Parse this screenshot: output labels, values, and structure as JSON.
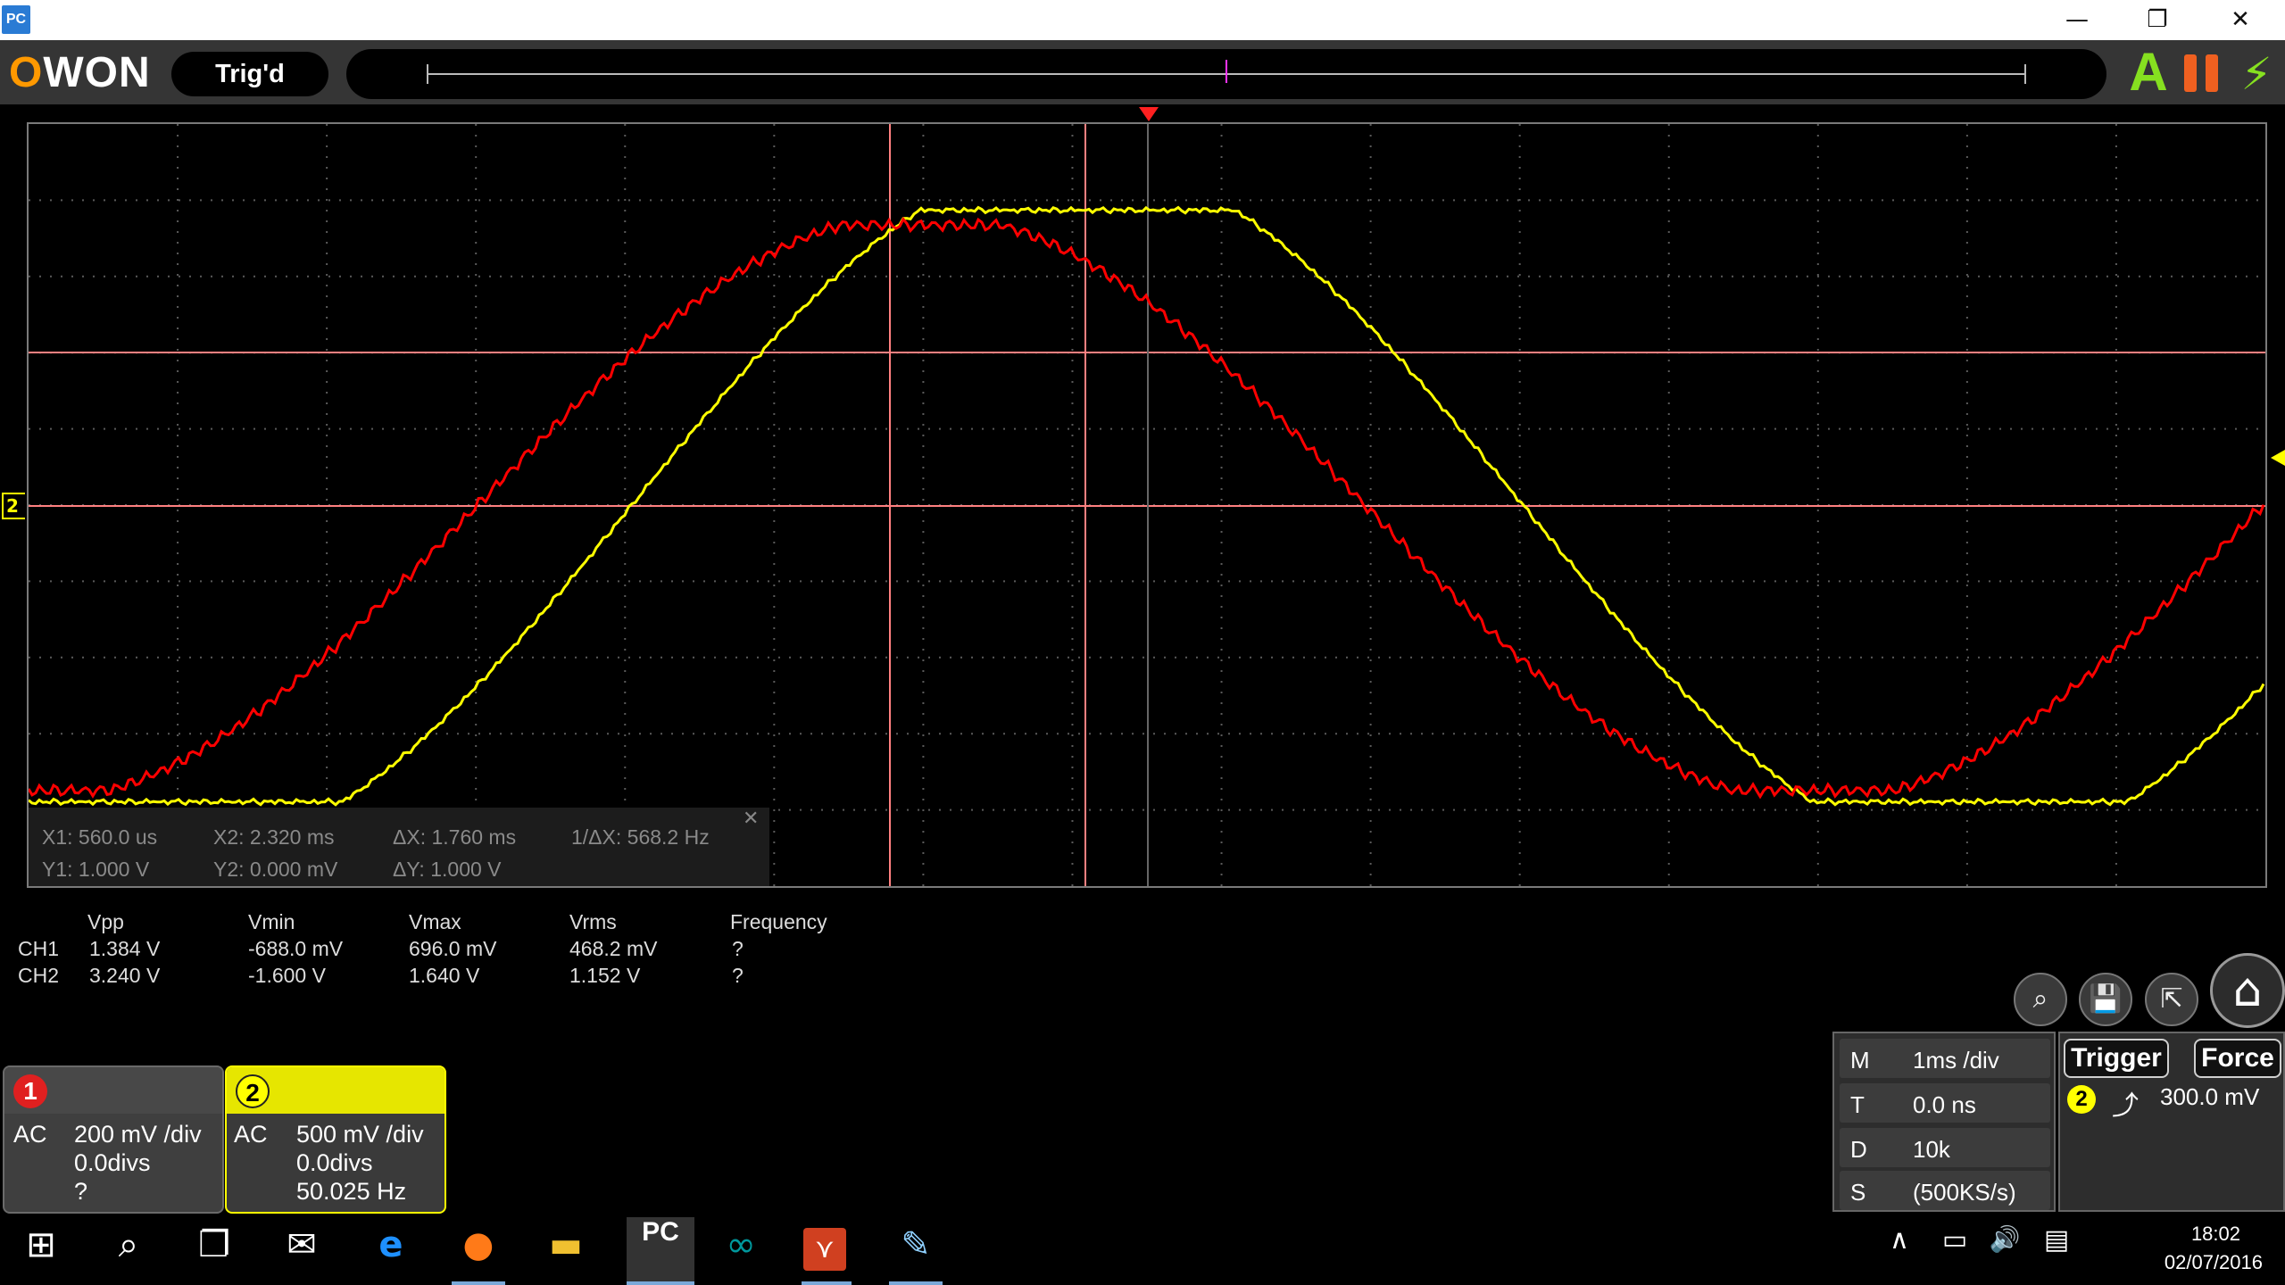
{
  "window": {
    "app_icon_text": "PC",
    "minimize": "—",
    "restore": "❐",
    "close": "✕"
  },
  "toolbar": {
    "logo_letters": [
      "O",
      "WON"
    ],
    "trigger_status": "Trig'd",
    "auto_label": "A",
    "single_label": "⚡",
    "colors": {
      "logo_accent": "#ff9900",
      "auto": "#86e020",
      "pause": "#f06020",
      "overview_marker": "#ff33ff"
    }
  },
  "screen": {
    "grid": {
      "h_divs": 10,
      "v_divs": 15
    },
    "ch2_marker": "2",
    "colors": {
      "ch1": "#ff0000",
      "ch2": "#ffff00",
      "cursor": "#ff8080",
      "grid": "#5a5a5a"
    }
  },
  "cursor_readout": {
    "x1": "X1: 560.0 us",
    "x2": "X2: 2.320 ms",
    "dx": "ΔX: 1.760 ms",
    "inv_dx": "1/ΔX: 568.2 Hz",
    "y1": "Y1: 1.000 V",
    "y2": "Y2: 0.000 mV",
    "dy": "ΔY: 1.000 V",
    "close": "✕"
  },
  "measurements": {
    "headers": [
      "Vpp",
      "Vmin",
      "Vmax",
      "Vrms",
      "Frequency"
    ],
    "rows": [
      {
        "ch": "CH1",
        "vpp": "1.384 V",
        "vmin": "-688.0 mV",
        "vmax": "696.0 mV",
        "vrms": "468.2 mV",
        "freq": "?"
      },
      {
        "ch": "CH2",
        "vpp": "3.240 V",
        "vmin": "-1.600 V",
        "vmax": "1.640 V",
        "vrms": "1.152 V",
        "freq": "?"
      }
    ]
  },
  "channels": [
    {
      "num": "1",
      "coupling": "AC",
      "scale": "200 mV /div",
      "offset": "0.0divs",
      "freq": "?"
    },
    {
      "num": "2",
      "coupling": "AC",
      "scale": "500 mV /div",
      "offset": "0.0divs",
      "freq": "50.025 Hz"
    }
  ],
  "controls": {
    "zoom_icon": "⌕",
    "save_icon": "💾",
    "export_icon": "⇱",
    "home_icon": "⌂"
  },
  "timebase": {
    "m_key": "M",
    "m_val": "1ms /div",
    "t_key": "T",
    "t_val": "0.0 ns",
    "d_key": "D",
    "d_val": "10k",
    "s_key": "S",
    "s_val": "(500KS/s)"
  },
  "trigger": {
    "trigger_label": "Trigger",
    "force_label": "Force",
    "source": "2",
    "edge_icon": "⤴",
    "level": "300.0 mV"
  },
  "taskbar": {
    "start_icon": "⊞",
    "search_icon": "⌕",
    "taskview_icon": "❐",
    "mail_icon": "✉",
    "edge_icon": "e",
    "firefox_icon": "●",
    "explorer_icon": "▬",
    "pc_icon": "PC",
    "arduino_icon": "∞",
    "app_icon": "⋎",
    "paint_icon": "✎",
    "tray_chevron": "∧",
    "tray_battery": "▭",
    "tray_volume": "🔊",
    "tray_notify": "▤",
    "time": "18:02",
    "date": "02/07/2016"
  }
}
